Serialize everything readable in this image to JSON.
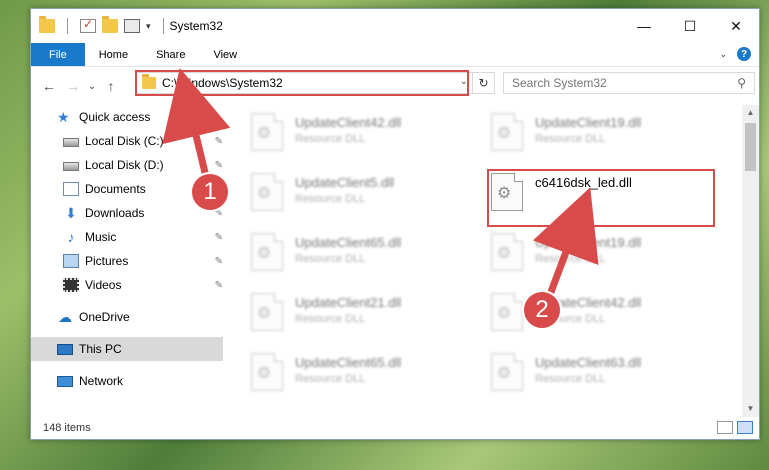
{
  "window": {
    "title": "System32"
  },
  "ribbon": {
    "tabs": [
      "File",
      "Home",
      "Share",
      "View"
    ],
    "help": "?"
  },
  "nav": {
    "back": "←",
    "forward": "→",
    "up": "↑",
    "recent": "⌄"
  },
  "address": {
    "path": "C:\\Windows\\System32",
    "dropdown": "⌄",
    "refresh": "↻"
  },
  "search": {
    "placeholder": "Search System32"
  },
  "sidebar": {
    "items": [
      {
        "label": "Quick access",
        "icon": "star-icon"
      },
      {
        "label": "Local Disk (C:)",
        "icon": "drive-icon",
        "pinned": true
      },
      {
        "label": "Local Disk (D:)",
        "icon": "drive-icon",
        "pinned": true
      },
      {
        "label": "Documents",
        "icon": "documents-icon",
        "pinned": true
      },
      {
        "label": "Downloads",
        "icon": "download-icon",
        "pinned": true
      },
      {
        "label": "Music",
        "icon": "music-icon",
        "pinned": true
      },
      {
        "label": "Pictures",
        "icon": "pictures-icon",
        "pinned": true
      },
      {
        "label": "Videos",
        "icon": "videos-icon",
        "pinned": true
      },
      {
        "label": "OneDrive",
        "icon": "cloud-icon"
      },
      {
        "label": "This PC",
        "icon": "pc-icon",
        "selected": true
      },
      {
        "label": "Network",
        "icon": "network-icon"
      }
    ]
  },
  "files": [
    {
      "name": "UpdateClient42.dll",
      "type": "Resource DLL"
    },
    {
      "name": "UpdateClient19.dll",
      "type": "Resource DLL"
    },
    {
      "name": "UpdateClient5.dll",
      "type": "Resource DLL"
    },
    {
      "name": "c6416dsk_led.dll",
      "type": ""
    },
    {
      "name": "UpdateClient65.dll",
      "type": "Resource DLL"
    },
    {
      "name": "UpdateClient19.dll",
      "type": "Resource DLL"
    },
    {
      "name": "UpdateClient21.dll",
      "type": "Resource DLL"
    },
    {
      "name": "UpdateClient42.dll",
      "type": "Resource DLL"
    },
    {
      "name": "UpdateClient65.dll",
      "type": "Resource DLL"
    },
    {
      "name": "UpdateClient63.dll",
      "type": "Resource DLL"
    }
  ],
  "status": {
    "count": "148 items"
  },
  "annotations": {
    "step1": "1",
    "step2": "2"
  },
  "colors": {
    "accent": "#1979ca",
    "highlight": "#d94b4b"
  }
}
